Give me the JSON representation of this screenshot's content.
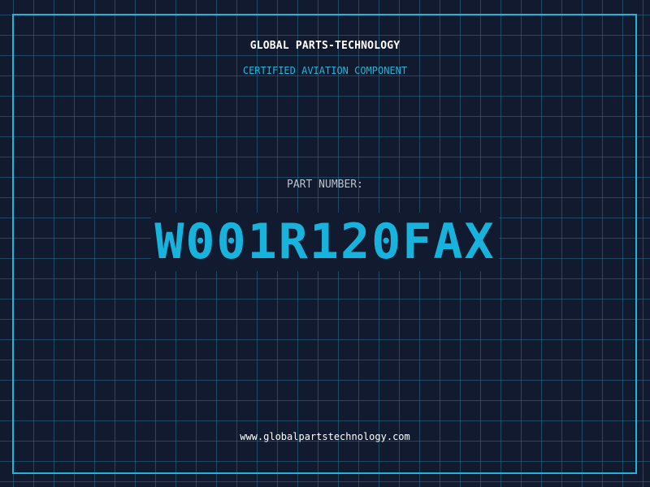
{
  "header": {
    "brand": "GLOBAL PARTS-TECHNOLOGY",
    "tagline": "CERTIFIED AVIATION COMPONENT"
  },
  "main": {
    "label": "PART NUMBER:",
    "part_number": "W001R120FAX"
  },
  "footer": {
    "url": "www.globalpartstechnology.com"
  },
  "colors": {
    "background": "#111a2e",
    "accent": "#17b3dc",
    "grid": "#266e8c",
    "text": "#ffffff",
    "muted": "#b9c3cf"
  }
}
